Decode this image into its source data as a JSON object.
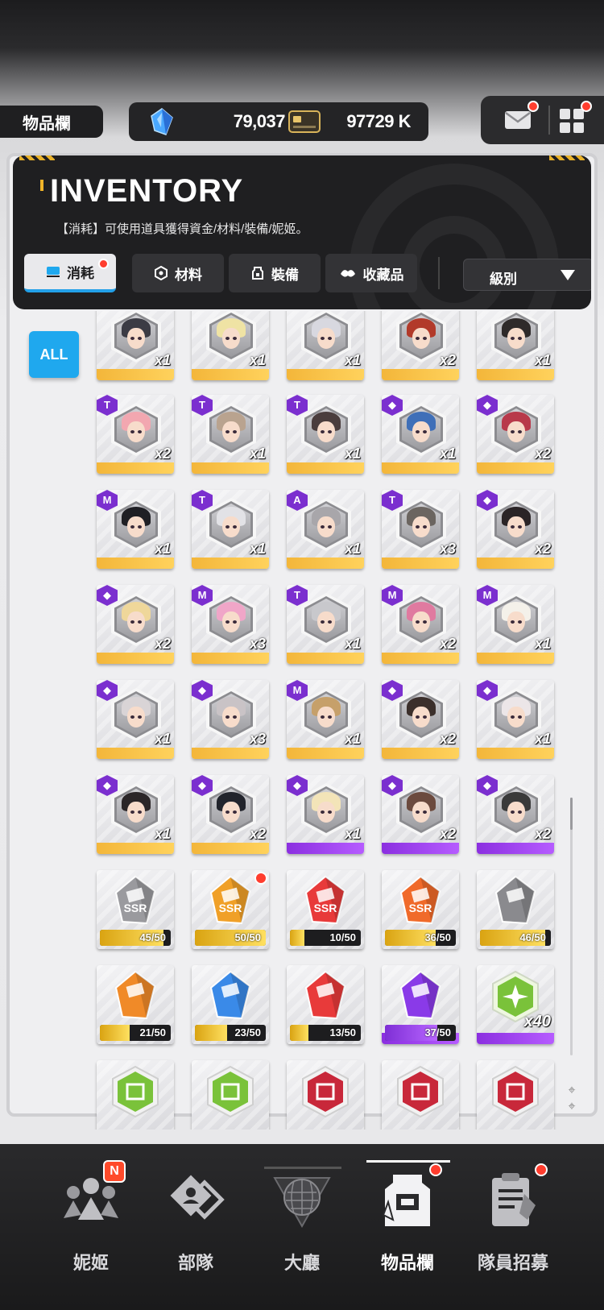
{
  "header": {
    "page_title": "物品欄",
    "gems": "79,037",
    "gems_plus": "+",
    "credits": "97729 K"
  },
  "inventory": {
    "title": "INVENTORY",
    "description": "【消耗】可使用道具獲得資金/材料/裝備/妮姬。",
    "tabs": [
      {
        "label": "消耗",
        "active": true,
        "icon": "consumable-icon",
        "badge": true
      },
      {
        "label": "材料",
        "active": false,
        "icon": "material-icon"
      },
      {
        "label": "裝備",
        "active": false,
        "icon": "equipment-icon"
      },
      {
        "label": "收藏品",
        "active": false,
        "icon": "collection-icon"
      }
    ],
    "sort_label": "級別",
    "filter_all": "ALL"
  },
  "portraits": [
    {
      "badge": "",
      "qty": "x1",
      "bar": "gold",
      "hair": "#3b3b44"
    },
    {
      "badge": "",
      "qty": "x1",
      "bar": "gold",
      "hair": "#efe3a4"
    },
    {
      "badge": "",
      "qty": "x1",
      "bar": "gold",
      "hair": "#d8d8e0"
    },
    {
      "badge": "",
      "qty": "x2",
      "bar": "gold",
      "hair": "#b23a2a"
    },
    {
      "badge": "",
      "qty": "x1",
      "bar": "gold",
      "hair": "#2e2a2a"
    },
    {
      "badge": "T",
      "qty": "x2",
      "bar": "gold",
      "hair": "#f2a7b0"
    },
    {
      "badge": "T",
      "qty": "x1",
      "bar": "gold",
      "hair": "#b9a38f"
    },
    {
      "badge": "T",
      "qty": "x1",
      "bar": "gold",
      "hair": "#4a3d3d"
    },
    {
      "badge": "◆",
      "qty": "x1",
      "bar": "gold",
      "hair": "#3f6fb8"
    },
    {
      "badge": "◆",
      "qty": "x2",
      "bar": "gold",
      "hair": "#b8394a"
    },
    {
      "badge": "M",
      "qty": "x1",
      "bar": "gold",
      "hair": "#1f1f24"
    },
    {
      "badge": "T",
      "qty": "x1",
      "bar": "gold",
      "hair": "#e2e2e6"
    },
    {
      "badge": "A",
      "qty": "x1",
      "bar": "gold",
      "hair": "#a8a6aa"
    },
    {
      "badge": "T",
      "qty": "x3",
      "bar": "gold",
      "hair": "#6b6560"
    },
    {
      "badge": "◆",
      "qty": "x2",
      "bar": "gold",
      "hair": "#2a2426"
    },
    {
      "badge": "◆",
      "qty": "x2",
      "bar": "gold",
      "hair": "#efd79a"
    },
    {
      "badge": "M",
      "qty": "x3",
      "bar": "gold",
      "hair": "#f0a6c8"
    },
    {
      "badge": "T",
      "qty": "x1",
      "bar": "gold",
      "hair": "#c8c8cc"
    },
    {
      "badge": "M",
      "qty": "x2",
      "bar": "gold",
      "hair": "#e07aa0"
    },
    {
      "badge": "M",
      "qty": "x1",
      "bar": "gold",
      "hair": "#f4f1ea"
    },
    {
      "badge": "◆",
      "qty": "x1",
      "bar": "gold",
      "hair": "#d9d4d6"
    },
    {
      "badge": "◆",
      "qty": "x3",
      "bar": "gold",
      "hair": "#c9c3c6"
    },
    {
      "badge": "M",
      "qty": "x1",
      "bar": "gold",
      "hair": "#c6a06a"
    },
    {
      "badge": "◆",
      "qty": "x2",
      "bar": "gold",
      "hair": "#3b2f2b"
    },
    {
      "badge": "◆",
      "qty": "x1",
      "bar": "gold",
      "hair": "#ece6e8"
    },
    {
      "badge": "◆",
      "qty": "x1",
      "bar": "gold",
      "hair": "#2b2628"
    },
    {
      "badge": "◆",
      "qty": "x2",
      "bar": "gold",
      "hair": "#22242c"
    },
    {
      "badge": "◆",
      "qty": "x1",
      "bar": "purple",
      "hair": "#f3e4b8"
    },
    {
      "badge": "◆",
      "qty": "x2",
      "bar": "purple",
      "hair": "#6b4a3e"
    },
    {
      "badge": "◆",
      "qty": "x2",
      "bar": "purple",
      "hair": "#3a3a3a"
    }
  ],
  "crystals": [
    {
      "label": "45/50",
      "progress": 0.9,
      "color": "#9a9a9e",
      "text": "SSR",
      "style": "gold"
    },
    {
      "label": "50/50",
      "progress": 1.0,
      "color": "#f0a028",
      "text": "SSR",
      "style": "gold",
      "notify": true
    },
    {
      "label": "10/50",
      "progress": 0.2,
      "color": "#e83a3a",
      "text": "SSR",
      "style": "gold"
    },
    {
      "label": "36/50",
      "progress": 0.72,
      "color": "#f06a2a",
      "text": "SSR",
      "style": "gold"
    },
    {
      "label": "46/50",
      "progress": 0.92,
      "color": "#8a8a8e",
      "text": "",
      "style": "gold"
    },
    {
      "label": "21/50",
      "progress": 0.42,
      "color": "#f08a28",
      "text": "",
      "style": "gold"
    },
    {
      "label": "23/50",
      "progress": 0.46,
      "color": "#3a8ae8",
      "text": "",
      "style": "gold"
    },
    {
      "label": "13/50",
      "progress": 0.26,
      "color": "#e83a3a",
      "text": "",
      "style": "gold"
    },
    {
      "label": "37/50",
      "progress": 0.74,
      "color": "#8a3ae8",
      "text": "",
      "style": "purple"
    },
    {
      "label": "x40",
      "progress": null,
      "color": "#7ac23a",
      "text": "",
      "style": "badge"
    }
  ],
  "bottom_row_colors": [
    "#7ac23a",
    "#7ac23a",
    "#c8283a",
    "#c8283a",
    "#c8283a"
  ],
  "nav": [
    {
      "label": "妮姬",
      "icon": "nikke-icon",
      "active": false,
      "badge": "N"
    },
    {
      "label": "部隊",
      "icon": "squad-icon",
      "active": false
    },
    {
      "label": "大廳",
      "icon": "lobby-icon",
      "active": false
    },
    {
      "label": "物品欄",
      "icon": "inventory-icon",
      "active": true,
      "dot": true
    },
    {
      "label": "隊員招募",
      "icon": "recruit-icon",
      "active": false,
      "dot": true
    }
  ],
  "colors": {
    "accent_blue": "#1fa8ee",
    "notify_red": "#ff3d2e",
    "rarity_gold": "#f3b63a",
    "rarity_purple": "#8b2fe0"
  }
}
